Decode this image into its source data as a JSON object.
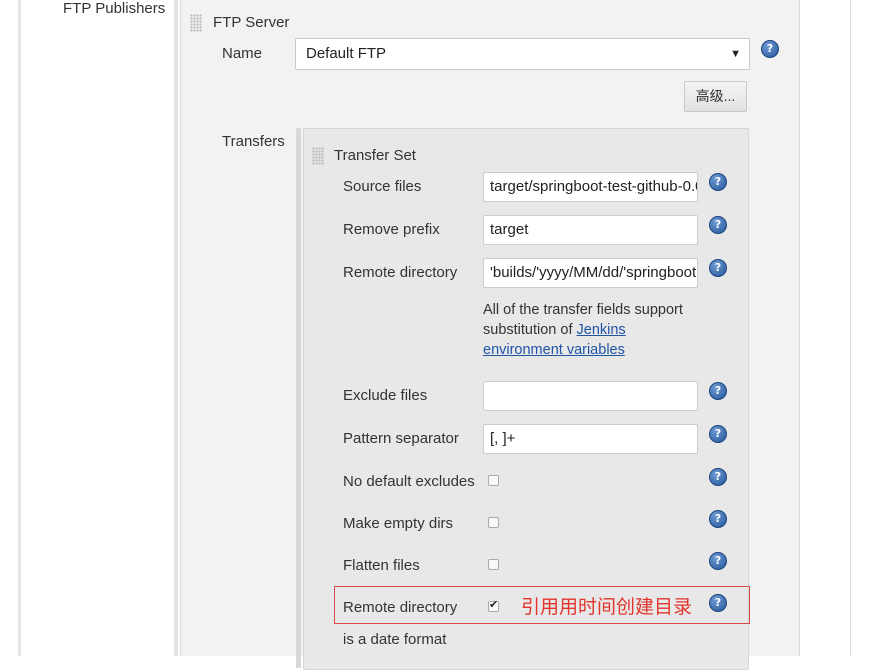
{
  "publishers": {
    "section_label": "FTP Publishers"
  },
  "server": {
    "heading": "FTP Server",
    "name_label": "Name",
    "name_value": "Default FTP",
    "advanced_button": "高级..."
  },
  "transfers": {
    "label": "Transfers",
    "set_heading": "Transfer Set",
    "source_files": {
      "label": "Source files",
      "value": "target/springboot-test-github-0.0"
    },
    "remove_prefix": {
      "label": "Remove prefix",
      "value": "target"
    },
    "remote_directory": {
      "label": "Remote directory",
      "value": "'builds/'yyyy/MM/dd/'springboot"
    },
    "note_text": "All of the transfer fields support",
    "note_text2": "substitution of",
    "note_link1": "Jenkins",
    "note_link2": "environment variables",
    "exclude_files": {
      "label": "Exclude files",
      "value": ""
    },
    "pattern_separator": {
      "label": "Pattern separator",
      "value": "[, ]+"
    },
    "no_default_excludes": {
      "label": "No default excludes",
      "checked": false
    },
    "make_empty_dirs": {
      "label": "Make empty dirs",
      "checked": false
    },
    "flatten_files": {
      "label": "Flatten files",
      "checked": false
    },
    "remote_dir_date": {
      "label": "Remote directory",
      "label2": "is a date format",
      "checked": true
    }
  },
  "annotation": {
    "text": "引用用时间创建目录",
    "color": "#e2342d"
  },
  "icons": {
    "help": "help-icon",
    "grip": "drag-handle-icon",
    "dropdown": "dropdown-arrow-icon"
  }
}
